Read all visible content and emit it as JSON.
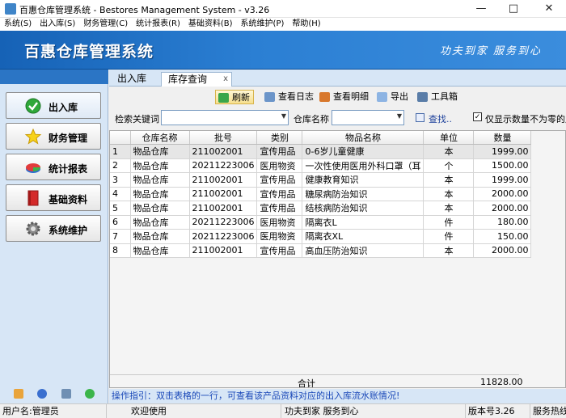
{
  "window": {
    "title": "百惠仓库管理系统 - Bestores Management System - v3.26",
    "minimize": "—",
    "maximize": "□",
    "close": "✕"
  },
  "menu": [
    "系统(S)",
    "出入库(S)",
    "财务管理(C)",
    "统计报表(R)",
    "基础资料(B)",
    "系统维护(P)",
    "帮助(H)"
  ],
  "banner": {
    "logo": "百惠仓库管理系统",
    "slogan": "功夫到家 服务到心"
  },
  "sidebar": {
    "items": [
      "出入库",
      "财务管理",
      "统计报表",
      "基础资料",
      "系统维护"
    ]
  },
  "tabs": {
    "t1": "出入库",
    "t2": "库存查询",
    "close": "x"
  },
  "toolbar": {
    "refresh": "刷新",
    "log": "查看日志",
    "detail": "查看明细",
    "export": "导出",
    "tools": "工具箱"
  },
  "search": {
    "keyword_label": "检索关键词",
    "warehouse_label": "仓库名称",
    "find": "查找..",
    "nonzero_label": "仅显示数量不为零的产品"
  },
  "table": {
    "headers": [
      "",
      "仓库名称",
      "批号",
      "类别",
      "物品名称",
      "单位",
      "数量"
    ],
    "rows": [
      [
        "1",
        "物品仓库",
        "211002001",
        "宣传用品",
        "0-6岁儿童健康",
        "本",
        "1999.00"
      ],
      [
        "2",
        "物品仓库",
        "20211223006",
        "医用物资",
        "一次性使用医用外科口罩（耳",
        "个",
        "1500.00"
      ],
      [
        "3",
        "物品仓库",
        "211002001",
        "宣传用品",
        "健康教育知识",
        "本",
        "1999.00"
      ],
      [
        "4",
        "物品仓库",
        "211002001",
        "宣传用品",
        "糖尿病防治知识",
        "本",
        "2000.00"
      ],
      [
        "5",
        "物品仓库",
        "211002001",
        "宣传用品",
        "结核病防治知识",
        "本",
        "2000.00"
      ],
      [
        "6",
        "物品仓库",
        "20211223006",
        "医用物资",
        "隔离衣L",
        "件",
        "180.00"
      ],
      [
        "7",
        "物品仓库",
        "20211223006",
        "医用物资",
        "隔离衣XL",
        "件",
        "150.00"
      ],
      [
        "8",
        "物品仓库",
        "211002001",
        "宣传用品",
        "高血压防治知识",
        "本",
        "2000.00"
      ]
    ],
    "total_label": "合计",
    "total_value": "11828.00"
  },
  "hint": "操作指引：双击表格的一行，可查看该产品资料对应的出入库流水账情况!",
  "status": {
    "user": "用户名:管理员",
    "welcome": "欢迎使用",
    "slogan": "功夫到家 服务到心",
    "version": "版本号3.26",
    "service": "服务热线"
  },
  "colors": {
    "banner": "#1662b6",
    "sidebar": "#d7e6f6",
    "hint_text": "#1a48b8"
  }
}
